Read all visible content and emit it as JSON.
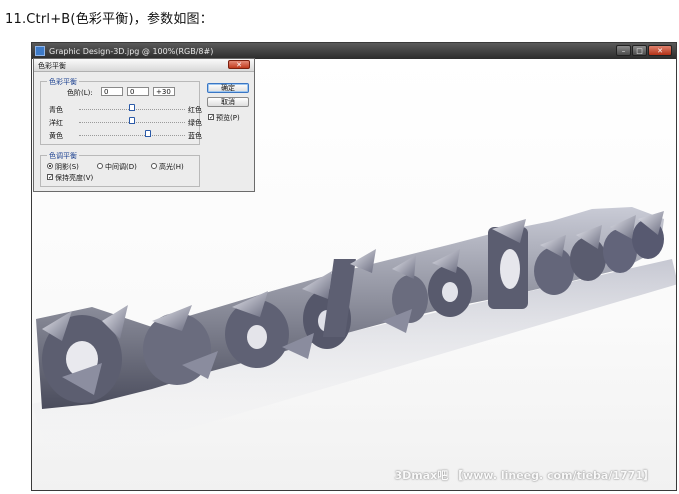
{
  "caption": "11.Ctrl+B(色彩平衡)，参数如图：",
  "document_window": {
    "title": "Graphic Design-3D.jpg @ 100%(RGB/8#)",
    "controls": {
      "minimize": "–",
      "maximize": "□",
      "close": "✕"
    },
    "watermark": "3Dmax吧  【www. lineeg. com/tieba/1771】"
  },
  "dialog": {
    "title": "色彩平衡",
    "close": "✕",
    "color_balance_group": {
      "legend": "色彩平衡",
      "levels_label": "色阶(L):",
      "levels": [
        "0",
        "0",
        "+30"
      ],
      "sliders": [
        {
          "left": "青色",
          "right": "红色",
          "value": 0
        },
        {
          "left": "洋红",
          "right": "绿色",
          "value": 0
        },
        {
          "left": "黄色",
          "right": "蓝色",
          "value": 30
        }
      ]
    },
    "tone_balance_group": {
      "legend": "色调平衡",
      "options": [
        "阴影(S)",
        "中间调(D)",
        "高光(H)"
      ],
      "selected": "阴影(S)",
      "preserve_luminosity": "保持亮度(V)",
      "preserve_checked": true
    },
    "buttons": {
      "ok": "确定",
      "cancel": "取消"
    },
    "preview": {
      "label": "预览(P)",
      "checked": true
    }
  }
}
